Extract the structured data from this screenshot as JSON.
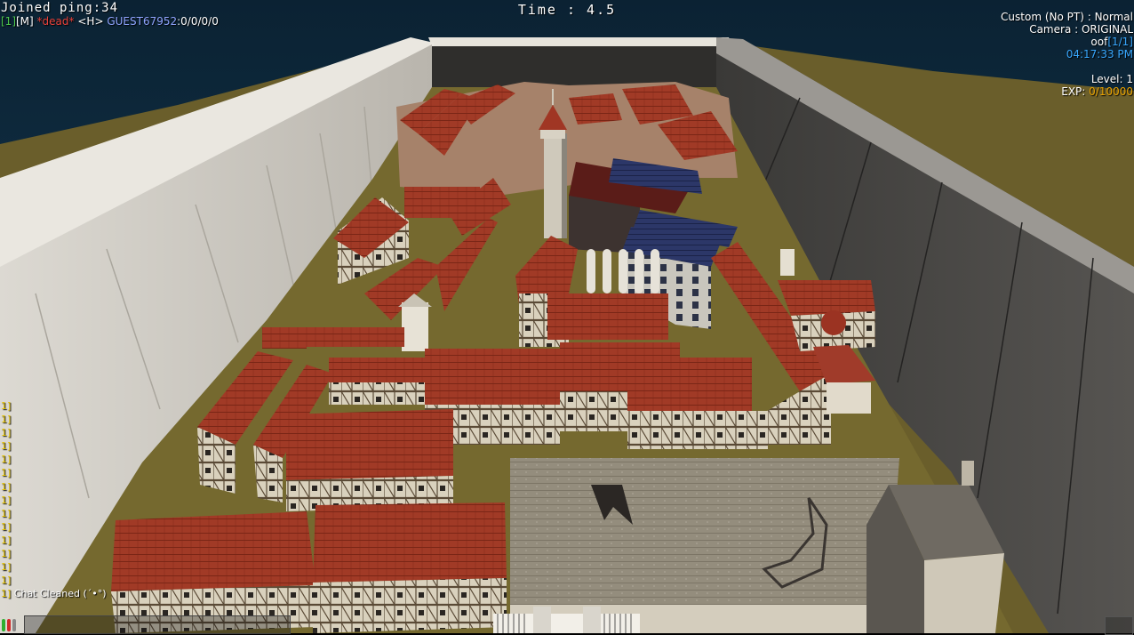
{
  "hud": {
    "joined_ping": "Joined ping:34",
    "player": {
      "slot": "[1]",
      "team": "[M]",
      "status": "*dead*",
      "horse": "<H>",
      "name": "GUEST67952",
      "stats": ":0/0/0/0"
    },
    "timer": "Time : 4.5",
    "game_mode": "Custom (No PT) : Normal",
    "camera": "Camera : ORIGINAL",
    "room_name": "oof",
    "room_count": "[1/1]",
    "clock": "04:17:33 PM",
    "level": "Level: 1",
    "exp_label": "EXP: ",
    "exp_value": "0/10000"
  },
  "chat": {
    "lines": [
      "1]",
      "1]",
      "1]",
      "1]",
      "1]",
      "1]",
      "1]",
      "1]",
      "1]",
      "1]",
      "1]",
      "1]",
      "1]",
      "1]"
    ],
    "last_prefix": "1]",
    "last_message": " Chat Cleaned (´•°)"
  },
  "colors": {
    "sky": "#0f2a3c",
    "ground": "#6b5f2c",
    "wall": "#cfcbc2",
    "roof_red": "#9b3322",
    "roof_blue": "#243461",
    "plaster": "#d8d0bb",
    "church_roof": "#8e8778",
    "player_name": "#8fa4ff",
    "dead_tag": "#e8413a",
    "chat_log": "#e4c200",
    "clock": "#38a8ff",
    "exp": "#e8a200"
  }
}
